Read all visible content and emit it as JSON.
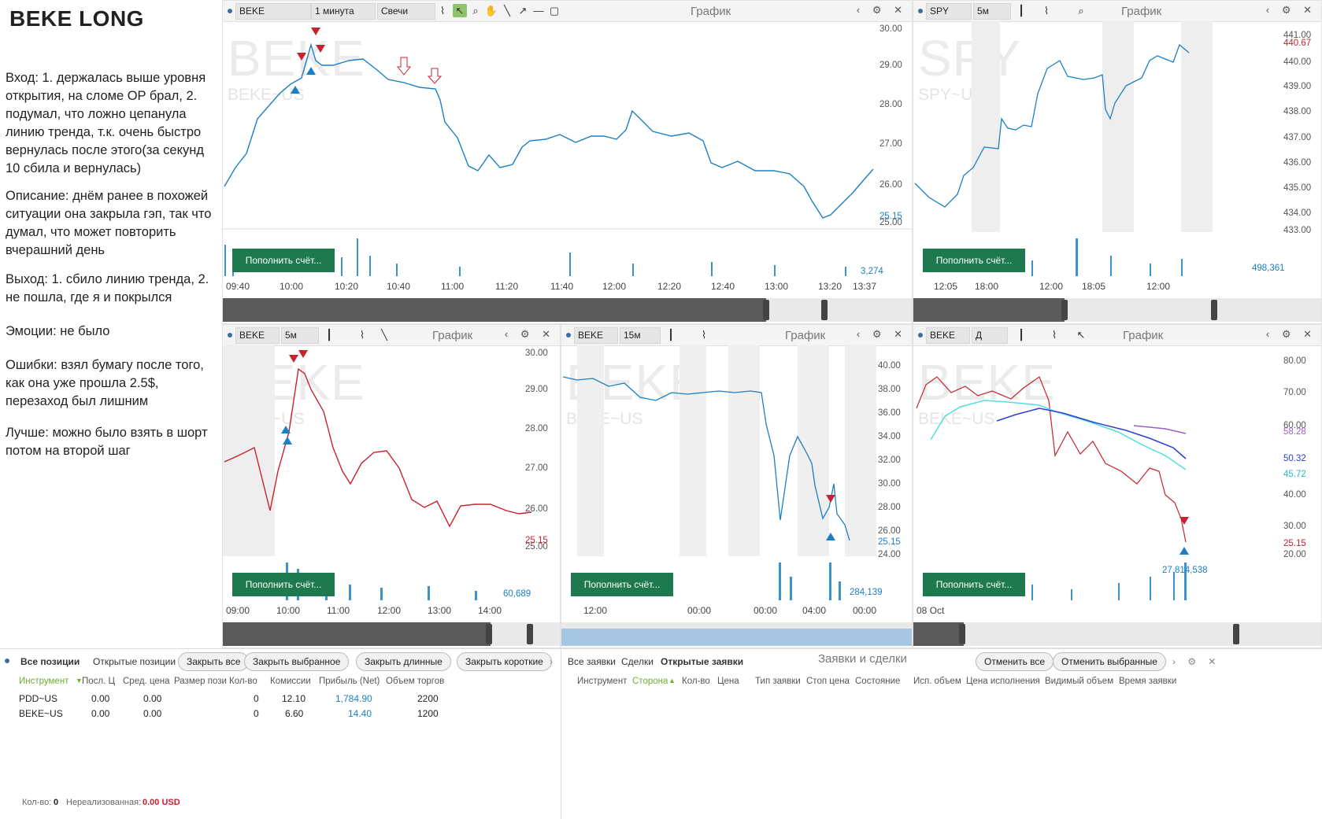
{
  "notes": {
    "title": "BEKE LONG",
    "paragraphs": [
      "Вход: 1. держалась выше уровня открытия, на сломе OP брал, 2. подумал, что ложно цепанула линию тренда, т.к. очень быстро вернулась после этого(за секунд 10 сбила и вернулась)",
      "Описание: днём ранее в похожей ситуации она закрыла гэп, так что думал, что может повторить вчерашний день",
      "Выход: 1. сбило линию тренда, 2. не пошла, где я и покрылся",
      "Эмоции: не было",
      "Ошибки: взял бумагу после того, как она уже прошла 2.5$, перезаход был лишним",
      "Лучше: можно было взять в шорт потом на второй шаг"
    ]
  },
  "common": {
    "graph_label": "График",
    "deposit_label": "Пополнить счёт..."
  },
  "panels": [
    {
      "symbol": "BEKE",
      "timeframe": "1 минута",
      "chart_type": "Свечи",
      "watermark": "BEKE",
      "watermark2": "BEKE~US",
      "yticks": [
        "30.00",
        "29.00",
        "28.00",
        "27.00",
        "26.00",
        "25.00"
      ],
      "last_price": "25.15",
      "volume_value": "3,274",
      "xticks": [
        "09:40",
        "10:00",
        "10:20",
        "10:40",
        "11:00",
        "11:20",
        "11:40",
        "12:00",
        "12:20",
        "12:40",
        "13:00",
        "13:20",
        "13:37"
      ]
    },
    {
      "symbol": "SPY",
      "timeframe": "5м",
      "watermark": "SPY",
      "watermark2": "SPY~US",
      "yticks": [
        "441.00",
        "440.00",
        "439.00",
        "438.00",
        "437.00",
        "436.00",
        "435.00",
        "434.00",
        "433.00"
      ],
      "last_price": "440.67",
      "volume_value": "498,361",
      "xticks": [
        "12:05",
        "18:00",
        "12:00",
        "18:05",
        "12:00"
      ]
    },
    {
      "symbol": "BEKE",
      "timeframe": "5м",
      "watermark": "BEKE",
      "watermark2": "BEKE~US",
      "yticks": [
        "30.00",
        "29.00",
        "28.00",
        "27.00",
        "26.00",
        "25.00"
      ],
      "last_price": "25.15",
      "volume_value": "60,689",
      "xticks": [
        "09:00",
        "10:00",
        "11:00",
        "12:00",
        "13:00",
        "14:00"
      ]
    },
    {
      "symbol": "BEKE",
      "timeframe": "15м",
      "watermark": "BEKE",
      "watermark2": "BEKE~US",
      "yticks": [
        "40.00",
        "38.00",
        "36.00",
        "34.00",
        "32.00",
        "30.00",
        "28.00",
        "26.00",
        "24.00"
      ],
      "last_price": "25.15",
      "volume_value": "284,139",
      "xticks": [
        "12:00",
        "00:00",
        "00:00",
        "04:00",
        "00:00"
      ]
    },
    {
      "symbol": "BEKE",
      "timeframe": "Д",
      "watermark": "BEKE",
      "watermark2": "BEKE~US",
      "yticks": [
        "80.00",
        "70.00",
        "60.00",
        "40.00",
        "30.00",
        "20.00"
      ],
      "last_price": "25.15",
      "volume_value": "27,814,538",
      "indicator_labels": [
        "58.28",
        "50.32",
        "45.72"
      ],
      "xticks": [
        "08 Oct"
      ]
    }
  ],
  "positions": {
    "tabs": [
      "Все позиции",
      "Открытые позиции"
    ],
    "buttons": [
      "Закрыть все",
      "Закрыть выбранное",
      "Закрыть длинные",
      "Закрыть короткие"
    ],
    "columns": [
      "Инструмент",
      "Посл. Ц",
      "Сред. цена",
      "Размер пози",
      "Кол-во",
      "Комиссии",
      "Прибыль (Net)",
      "Объем торгов"
    ],
    "rows": [
      [
        "PDD~US",
        "0.00",
        "0.00",
        "",
        "0",
        "12.10",
        "1,784.90",
        "2200"
      ],
      [
        "BEKE~US",
        "0.00",
        "0.00",
        "",
        "0",
        "6.60",
        "14.40",
        "1200"
      ]
    ],
    "footer_qty_label": "Кол-во:",
    "footer_qty": "0",
    "footer_unreal_label": "Нереализованная:",
    "footer_unreal": "0.00 USD"
  },
  "orders": {
    "tabs": [
      "Все заявки",
      "Сделки",
      "Открытые заявки"
    ],
    "title": "Заявки и сделки",
    "buttons": [
      "Отменить все",
      "Отменить выбранные"
    ],
    "columns": [
      "Инструмент",
      "Сторона",
      "Кол-во",
      "Цена",
      "Тип заявки",
      "Стоп цена",
      "Состояние",
      "Исп. объем",
      "Цена исполнения",
      "Видимый объем",
      "Время заявки"
    ]
  },
  "colors": {
    "up": "#1b7fc4",
    "down": "#c8222e",
    "deposit": "#1e7a4e",
    "accent_green": "#6fae2e",
    "profit": "#1b7fc4",
    "loss_red": "#c8222e"
  }
}
